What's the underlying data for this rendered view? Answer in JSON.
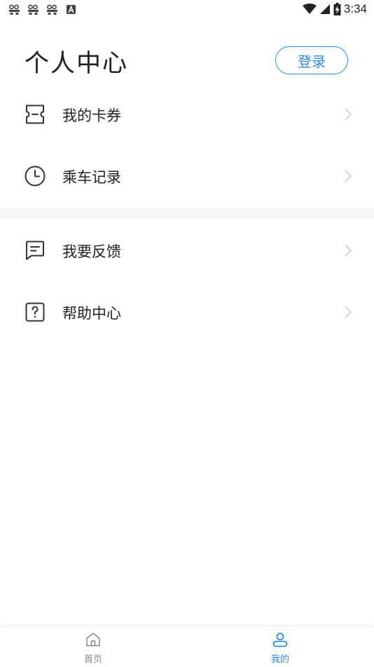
{
  "status_bar": {
    "time": "3:34",
    "notification_icons": [
      "game-controller-icon",
      "game-controller-icon",
      "game-controller-icon",
      "a-letter-icon"
    ],
    "system_icons": [
      "wifi-icon",
      "cell-signal-icon",
      "battery-charging-icon"
    ]
  },
  "header": {
    "title": "个人中心",
    "login_label": "登录"
  },
  "menu": {
    "items": [
      {
        "label": "我的卡券",
        "icon": "ticket-icon"
      },
      {
        "label": "乘车记录",
        "icon": "clock-icon"
      },
      {
        "label": "我要反馈",
        "icon": "feedback-message-icon"
      },
      {
        "label": "帮助中心",
        "icon": "help-question-icon"
      }
    ]
  },
  "tab_bar": {
    "tabs": [
      {
        "label": "首页",
        "icon": "home-icon",
        "active": false
      },
      {
        "label": "我的",
        "icon": "user-profile-icon",
        "active": true
      }
    ]
  },
  "colors": {
    "accent": "#2d8ce6",
    "text": "#222222",
    "muted": "#888888",
    "divider": "#f6f6f6"
  }
}
